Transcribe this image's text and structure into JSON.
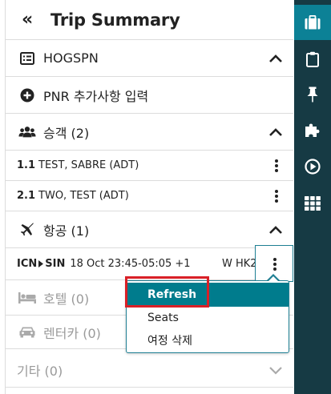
{
  "panel": {
    "title": "Trip Summary",
    "collapse_icon": "double-chevron-left-icon"
  },
  "pnr_section": {
    "label": "HOGSPN",
    "icon": "list-icon"
  },
  "add_pnr": {
    "label": "PNR 추가사항 입력",
    "icon": "plus-circle-icon"
  },
  "passengers": {
    "label": "승객 (2)",
    "icon": "users-icon",
    "items": [
      {
        "num": "1.1",
        "name": "TEST, SABRE (ADT)"
      },
      {
        "num": "2.1",
        "name": "TWO, TEST (ADT)"
      }
    ]
  },
  "air": {
    "label": "항공 (1)",
    "icon": "plane-icon",
    "segment": {
      "from": "ICN",
      "to": "SIN",
      "detail": "18 Oct 23:45-05:05 +1",
      "status": "W HK2"
    }
  },
  "hotel": {
    "label": "호텔 (0)",
    "icon": "bed-icon"
  },
  "car": {
    "label": "렌터카 (0)",
    "icon": "car-icon"
  },
  "other": {
    "label": "기타 (0)"
  },
  "context_menu": {
    "items": [
      {
        "label": "Refresh"
      },
      {
        "label": "Seats"
      },
      {
        "label": "여정 삭제"
      }
    ]
  },
  "rail": {
    "tabs": [
      "briefcase-icon",
      "clipboard-icon",
      "pin-icon",
      "puzzle-icon",
      "play-circle-icon",
      "grid-icon"
    ]
  },
  "colors": {
    "accent": "#007c8d",
    "rail": "#163a44",
    "highlight": "#d92027"
  }
}
